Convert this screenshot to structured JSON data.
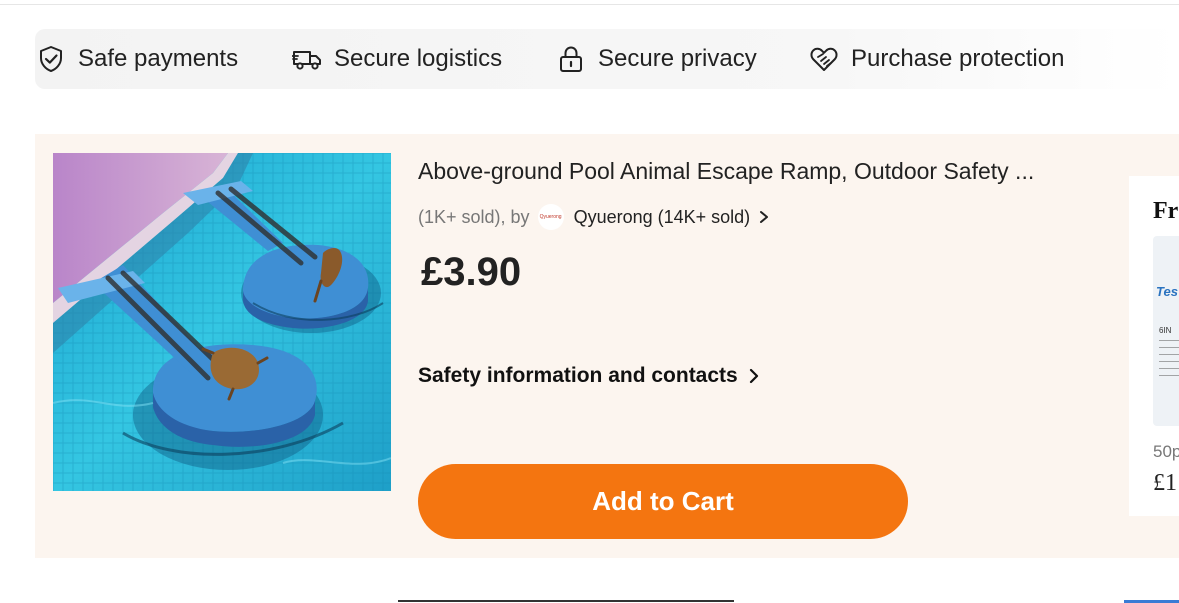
{
  "trust_bar": {
    "items": [
      {
        "label": "Safe payments",
        "icon": "shield-check-icon"
      },
      {
        "label": "Secure logistics",
        "icon": "truck-icon"
      },
      {
        "label": "Secure privacy",
        "icon": "lock-icon"
      },
      {
        "label": "Purchase protection",
        "icon": "handshake-heart-icon"
      }
    ]
  },
  "product": {
    "title": "Above-ground Pool Animal Escape Ramp, Outdoor Safety ...",
    "sold_count": "(1K+ sold), by",
    "store_logo_text": "Qyuerong",
    "store_name": "Qyuerong (14K+ sold)",
    "price": "£3.90",
    "safety_link": "Safety information and contacts",
    "add_to_cart": "Add to Cart"
  },
  "side_card": {
    "title": "Fr",
    "image_label_top": "Tes",
    "image_label_mid": "6IN",
    "subtitle": "50p",
    "price": "£1"
  },
  "colors": {
    "accent": "#f47510",
    "card_background": "#fcf5ef",
    "trust_bar_background": "#f3f3f3"
  }
}
